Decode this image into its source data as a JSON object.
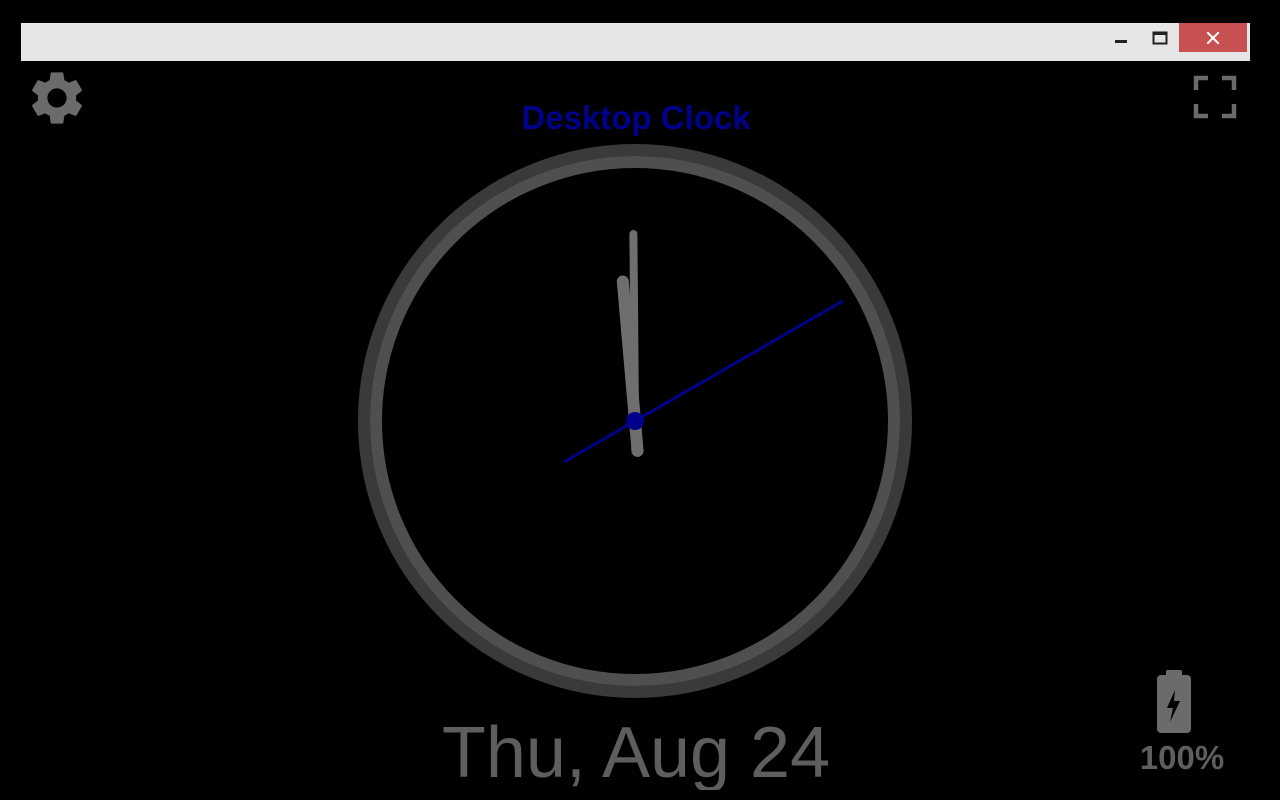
{
  "window": {
    "minimize_icon": "minimize-icon",
    "maximize_icon": "maximize-icon",
    "close_icon": "close-icon",
    "titlebar_color": "#e6e6e6",
    "close_color": "#c75050"
  },
  "toolbar": {
    "settings_icon": "gear-icon",
    "fullscreen_icon": "fullscreen-icon"
  },
  "app": {
    "title": "Desktop Clock",
    "accent_color": "#00008b"
  },
  "clock": {
    "time": {
      "hours": 11,
      "minutes": 59,
      "seconds": 10
    },
    "face_color": "#4a4a4a",
    "hand_color": "#6e6e6e",
    "second_hand_color": "#00008b"
  },
  "date": {
    "text": "Thu, Aug 24"
  },
  "battery": {
    "icon": "battery-charging-icon",
    "level_text": "100%",
    "level": 1.0
  }
}
